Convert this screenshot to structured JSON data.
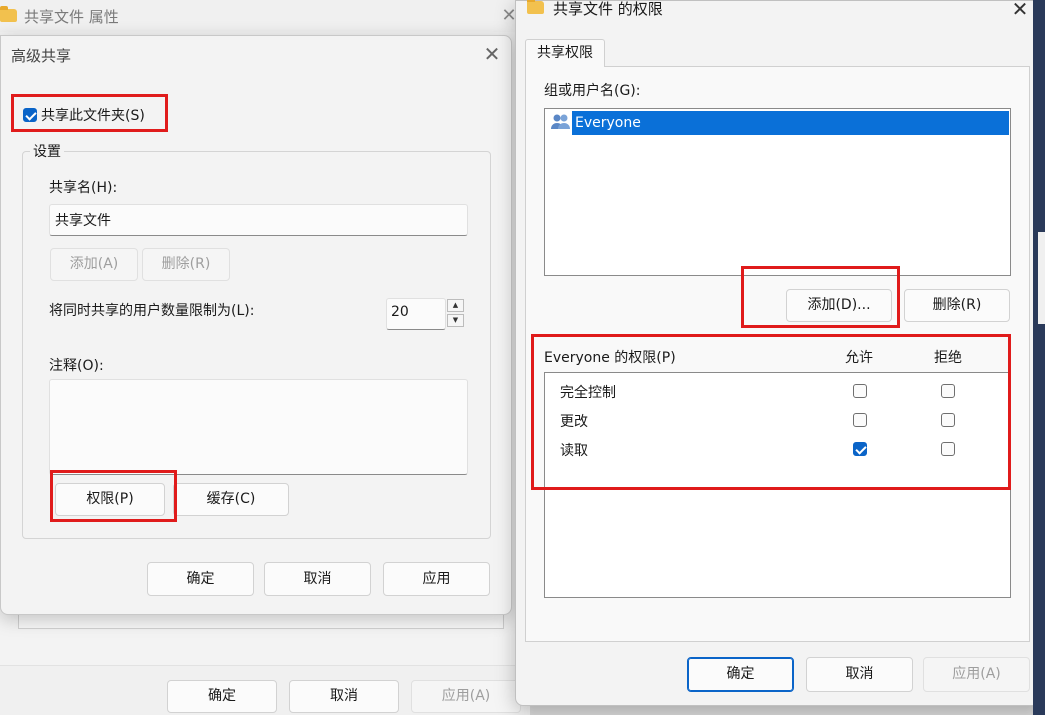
{
  "props_window": {
    "title": "共享文件 属性",
    "footer": {
      "ok_label": "确定",
      "cancel_label": "取消",
      "apply_label": "应用(A)"
    }
  },
  "advanced_sharing": {
    "title": "高级共享",
    "share_checkbox": {
      "label": "共享此文件夹(S)",
      "checked": true
    },
    "settings_legend": "设置",
    "share_name_label": "共享名(H):",
    "share_name_value": "共享文件",
    "add_label": "添加(A)",
    "remove_label": "删除(R)",
    "user_limit_label": "将同时共享的用户数量限制为(L):",
    "user_limit_value": "20",
    "comment_label": "注释(O):",
    "comment_value": "",
    "permissions_button": "权限(P)",
    "caching_button": "缓存(C)",
    "ok_label": "确定",
    "cancel_label": "取消",
    "apply_label": "应用"
  },
  "permissions_dialog": {
    "title": "共享文件 的权限",
    "tab_label": "共享权限",
    "group_label": "组或用户名(G):",
    "users": [
      {
        "name": "Everyone",
        "selected": true
      }
    ],
    "add_label": "添加(D)...",
    "remove_label": "删除(R)",
    "perm_header": "Everyone 的权限(P)",
    "allow_header": "允许",
    "deny_header": "拒绝",
    "permissions": [
      {
        "name": "完全控制",
        "allow": false,
        "deny": false
      },
      {
        "name": "更改",
        "allow": false,
        "deny": false
      },
      {
        "name": "读取",
        "allow": true,
        "deny": false
      }
    ],
    "ok_label": "确定",
    "cancel_label": "取消",
    "apply_label": "应用(A)"
  },
  "colors": {
    "accent": "#0a64c8",
    "highlight_box": "#e01b1b",
    "selection": "#0a70d8"
  }
}
